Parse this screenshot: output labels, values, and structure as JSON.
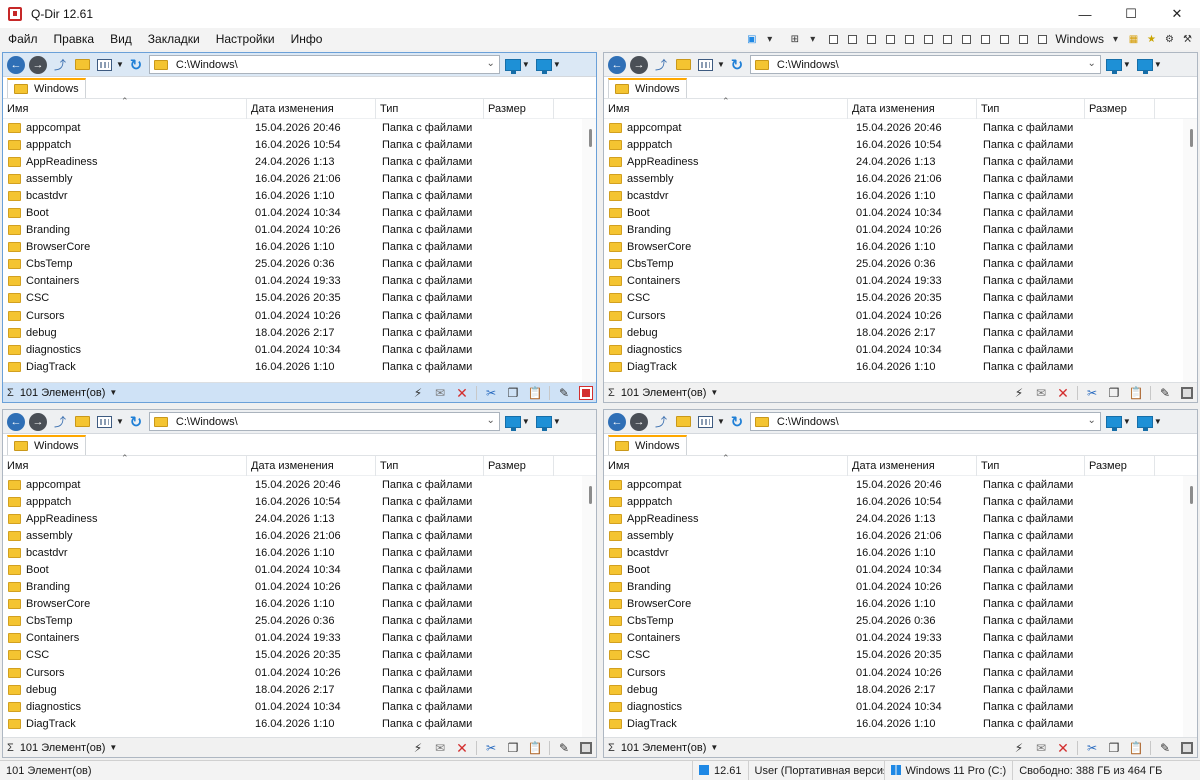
{
  "window": {
    "title": "Q-Dir 12.61"
  },
  "menu": {
    "items": [
      "Файл",
      "Правка",
      "Вид",
      "Закладки",
      "Настройки",
      "Инфо"
    ],
    "windows_label": "Windows"
  },
  "pane": {
    "path": "C:\\Windows\\",
    "tab_label": "Windows",
    "columns": {
      "name": "Имя",
      "date": "Дата изменения",
      "type": "Тип",
      "size": "Размер"
    },
    "item_count": "101 Элемент(ов)",
    "rows": [
      {
        "name": "appcompat",
        "date": "15.04.2026 20:46",
        "type": "Папка с файлами"
      },
      {
        "name": "apppatch",
        "date": "16.04.2026 10:54",
        "type": "Папка с файлами"
      },
      {
        "name": "AppReadiness",
        "date": "24.04.2026 1:13",
        "type": "Папка с файлами"
      },
      {
        "name": "assembly",
        "date": "16.04.2026 21:06",
        "type": "Папка с файлами"
      },
      {
        "name": "bcastdvr",
        "date": "16.04.2026 1:10",
        "type": "Папка с файлами"
      },
      {
        "name": "Boot",
        "date": "01.04.2024 10:34",
        "type": "Папка с файлами"
      },
      {
        "name": "Branding",
        "date": "01.04.2024 10:26",
        "type": "Папка с файлами"
      },
      {
        "name": "BrowserCore",
        "date": "16.04.2026 1:10",
        "type": "Папка с файлами"
      },
      {
        "name": "CbsTemp",
        "date": "25.04.2026 0:36",
        "type": "Папка с файлами"
      },
      {
        "name": "Containers",
        "date": "01.04.2024 19:33",
        "type": "Папка с файлами"
      },
      {
        "name": "CSC",
        "date": "15.04.2026 20:35",
        "type": "Папка с файлами"
      },
      {
        "name": "Cursors",
        "date": "01.04.2024 10:26",
        "type": "Папка с файлами"
      },
      {
        "name": "debug",
        "date": "18.04.2026 2:17",
        "type": "Папка с файлами"
      },
      {
        "name": "diagnostics",
        "date": "01.04.2024 10:34",
        "type": "Папка с файлами"
      },
      {
        "name": "DiagTrack",
        "date": "16.04.2026 1:10",
        "type": "Папка с файлами"
      }
    ]
  },
  "statusbar": {
    "count": "101 Элемент(ов)",
    "version": "12.61",
    "user": "User (Портативная версия)",
    "os": "Windows  11 Pro (C:)",
    "disk": "Свободно: 388 ГБ из 464 ГБ"
  }
}
